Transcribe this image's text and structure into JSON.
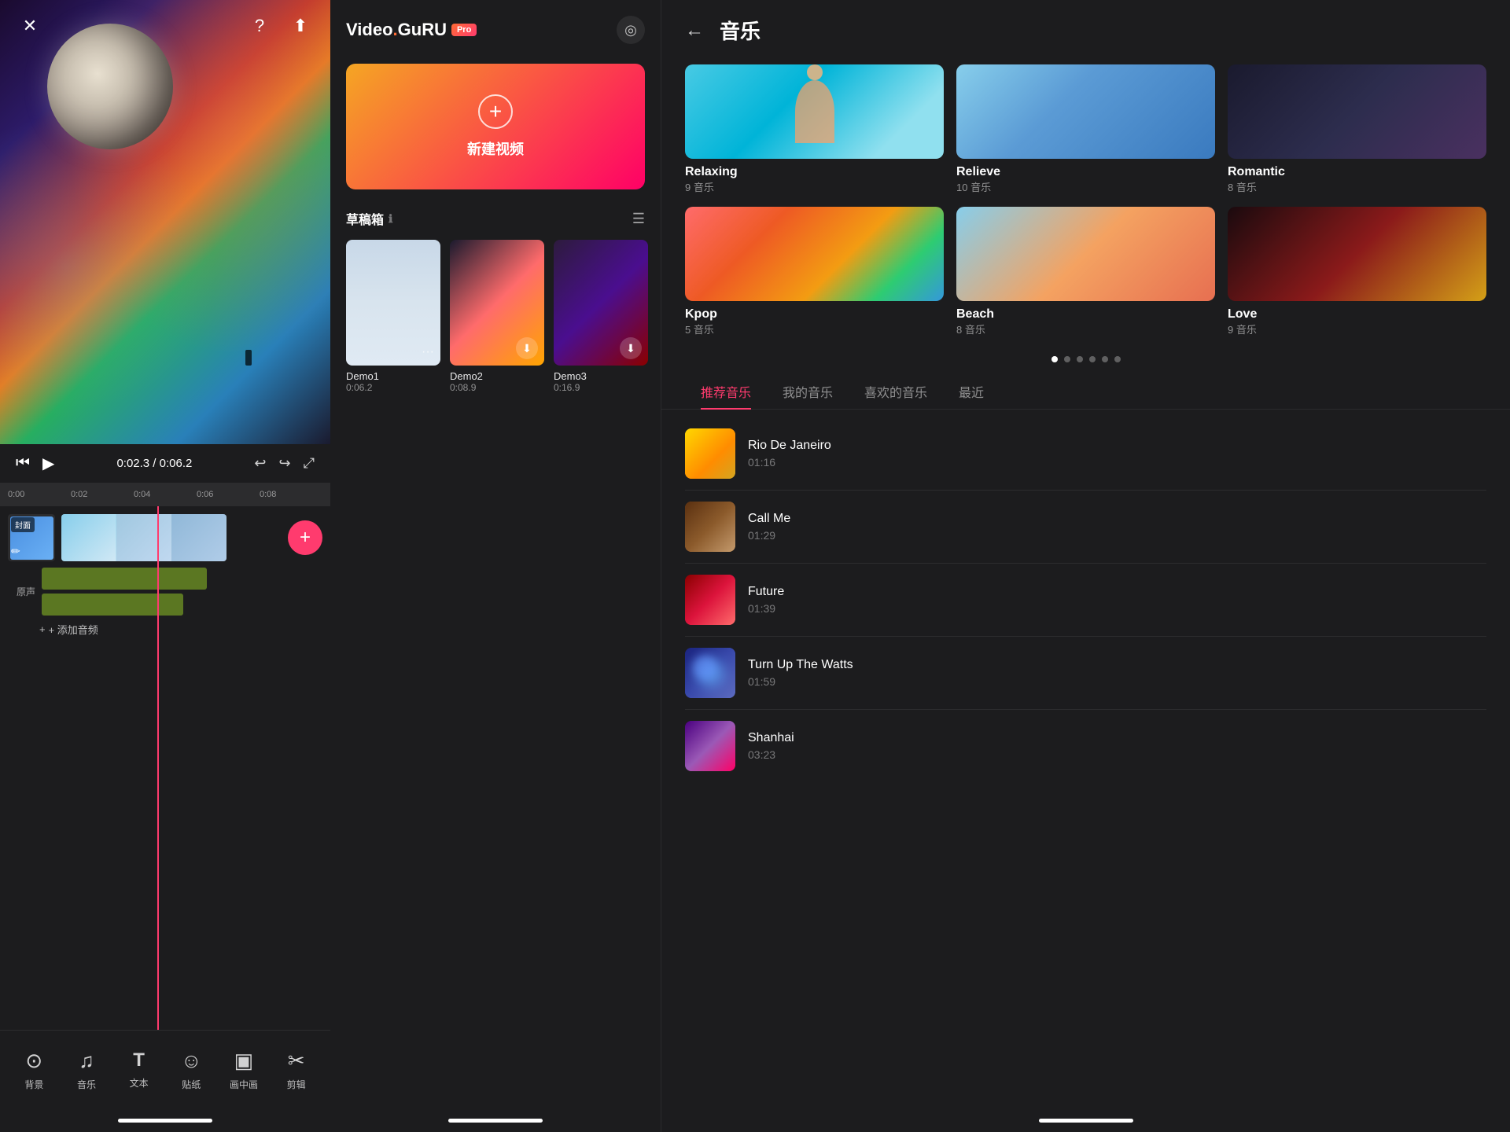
{
  "leftPanel": {
    "playback": {
      "time": "0:02.3 / 0:06.2",
      "rulerMarks": [
        "0:00",
        "0:02",
        "0:04",
        "0:06",
        "0:08"
      ]
    },
    "track": {
      "coverLabel": "封面",
      "addAudioLabel": "+ 添加音频"
    },
    "toolbar": {
      "items": [
        {
          "id": "background",
          "icon": "⊙",
          "label": "背景"
        },
        {
          "id": "music",
          "icon": "♫",
          "label": "音乐"
        },
        {
          "id": "text",
          "icon": "T",
          "label": "文本"
        },
        {
          "id": "sticker",
          "icon": "☺",
          "label": "贴纸"
        },
        {
          "id": "canvas",
          "icon": "□",
          "label": "画中画"
        },
        {
          "id": "edit",
          "icon": "✂",
          "label": "剪辑"
        }
      ]
    }
  },
  "middlePanel": {
    "logo": {
      "text": "Video",
      "dot": ".",
      "brand": "GuRU",
      "pro": "Pro"
    },
    "newVideo": {
      "label": "新建视频"
    },
    "drafts": {
      "title": "草稿箱",
      "items": [
        {
          "id": "demo1",
          "name": "Demo1",
          "duration": "0:06.2"
        },
        {
          "id": "demo2",
          "name": "Demo2",
          "duration": "0:08.9"
        },
        {
          "id": "demo3",
          "name": "Demo3",
          "duration": "0:16.9"
        }
      ]
    }
  },
  "rightPanel": {
    "title": "音乐",
    "categories": [
      {
        "id": "relaxing",
        "name": "Relaxing",
        "count": "9 音乐"
      },
      {
        "id": "relieve",
        "name": "Relieve",
        "count": "10 音乐"
      },
      {
        "id": "romantic",
        "name": "Romantic",
        "count": "8 音乐"
      },
      {
        "id": "kpop",
        "name": "Kpop",
        "count": "5 音乐"
      },
      {
        "id": "beach",
        "name": "Beach",
        "count": "8 音乐"
      },
      {
        "id": "love",
        "name": "Love",
        "count": "9 音乐"
      }
    ],
    "tabs": [
      {
        "id": "recommended",
        "label": "推荐音乐",
        "active": true
      },
      {
        "id": "my",
        "label": "我的音乐",
        "active": false
      },
      {
        "id": "liked",
        "label": "喜欢的音乐",
        "active": false
      },
      {
        "id": "recent",
        "label": "最近",
        "active": false
      }
    ],
    "tracks": [
      {
        "id": "rio",
        "name": "Rio De Janeiro",
        "duration": "01:16"
      },
      {
        "id": "callme",
        "name": "Call Me",
        "duration": "01:29"
      },
      {
        "id": "future",
        "name": "Future",
        "duration": "01:39"
      },
      {
        "id": "watts",
        "name": "Turn Up The Watts",
        "duration": "01:59"
      },
      {
        "id": "shanhai",
        "name": "Shanhai",
        "duration": "03:23"
      }
    ]
  }
}
